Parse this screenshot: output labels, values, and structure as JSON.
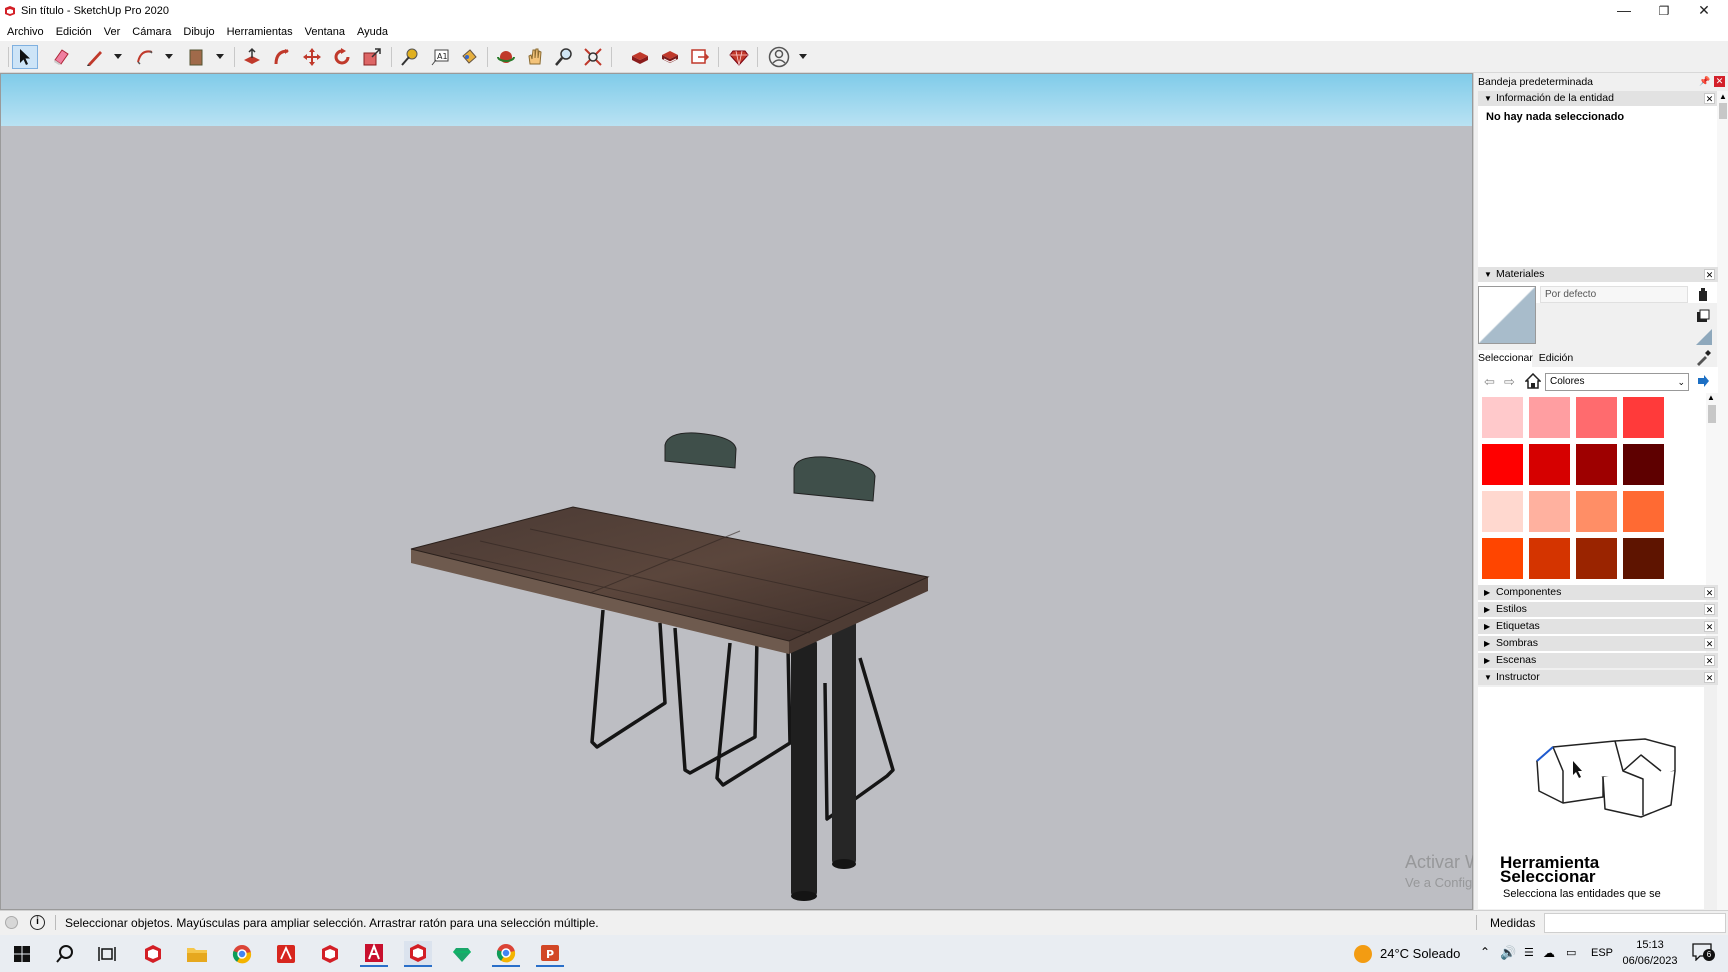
{
  "window": {
    "title": "Sin título - SketchUp Pro 2020",
    "minimize_icon": "minimize-icon",
    "maximize_icon": "restore-icon",
    "close_icon": "close-icon"
  },
  "menu": [
    "Archivo",
    "Edición",
    "Ver",
    "Cámara",
    "Dibujo",
    "Herramientas",
    "Ventana",
    "Ayuda"
  ],
  "tray": {
    "title": "Bandeja predeterminada",
    "entity_info": {
      "header": "Información de la entidad",
      "message": "No hay nada seleccionado"
    },
    "materials": {
      "header": "Materiales",
      "name_field": "Por defecto",
      "tab_select": "Seleccionar",
      "tab_edit": "Edición",
      "collection": "Colores",
      "swatches": [
        "#ffc9cb",
        "#ff9ea1",
        "#ff6b6e",
        "#ff3a3a",
        "#ff0000",
        "#d60000",
        "#9e0000",
        "#5e0000",
        "#ffd8cf",
        "#ffb19f",
        "#ff8e66",
        "#ff6a33",
        "#ff4500",
        "#d43400",
        "#9a2400",
        "#5e1400"
      ]
    },
    "collapsed_panels": [
      "Componentes",
      "Estilos",
      "Etiquetas",
      "Sombras",
      "Escenas"
    ],
    "instructor": {
      "header": "Instructor",
      "tool_title_line1": "Herramienta",
      "tool_title_line2": "Seleccionar",
      "description": "Selecciona las entidades que se"
    }
  },
  "watermark": {
    "line1": "Activar Windows",
    "line2": "Ve a Configuración para activar Windows."
  },
  "status": {
    "message": "Seleccionar objetos. Mayúsculas para ampliar selección. Arrastrar ratón para una selección múltiple.",
    "measure_label": "Medidas",
    "measure_value": ""
  },
  "taskbar": {
    "weather": "24°C  Soleado",
    "language": "ESP",
    "time": "15:13",
    "date": "06/06/2023",
    "notifications": "6"
  }
}
